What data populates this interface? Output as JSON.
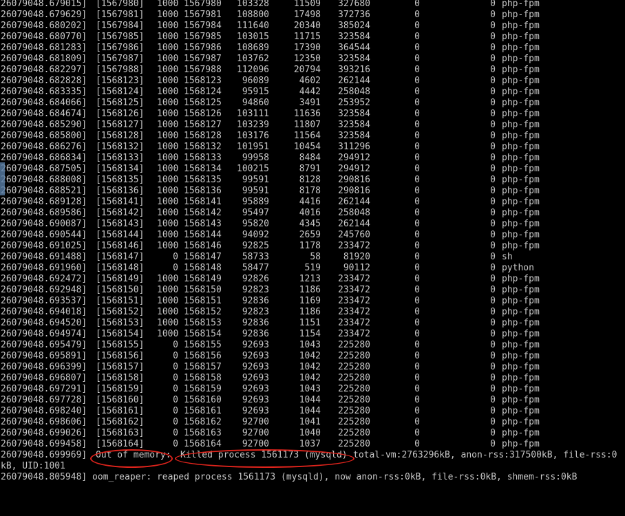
{
  "rows": [
    [
      "26079048.679015]",
      "[1567980]",
      "1000",
      "1567980",
      "103328",
      "11509",
      "327680",
      "0",
      "0",
      "php-fpm"
    ],
    [
      "26079048.679629]",
      "[1567981]",
      "1000",
      "1567981",
      "108800",
      "17498",
      "372736",
      "0",
      "0",
      "php-fpm"
    ],
    [
      "26079048.680202]",
      "[1567984]",
      "1000",
      "1567984",
      "111640",
      "20340",
      "385024",
      "0",
      "0",
      "php-fpm"
    ],
    [
      "26079048.680770]",
      "[1567985]",
      "1000",
      "1567985",
      "103015",
      "11715",
      "323584",
      "0",
      "0",
      "php-fpm"
    ],
    [
      "26079048.681283]",
      "[1567986]",
      "1000",
      "1567986",
      "108689",
      "17390",
      "364544",
      "0",
      "0",
      "php-fpm"
    ],
    [
      "26079048.681809]",
      "[1567987]",
      "1000",
      "1567987",
      "103762",
      "12350",
      "323584",
      "0",
      "0",
      "php-fpm"
    ],
    [
      "26079048.682297]",
      "[1567988]",
      "1000",
      "1567988",
      "112096",
      "20794",
      "393216",
      "0",
      "0",
      "php-fpm"
    ],
    [
      "26079048.682828]",
      "[1568123]",
      "1000",
      "1568123",
      "96089",
      "4602",
      "262144",
      "0",
      "0",
      "php-fpm"
    ],
    [
      "26079048.683335]",
      "[1568124]",
      "1000",
      "1568124",
      "95915",
      "4442",
      "258048",
      "0",
      "0",
      "php-fpm"
    ],
    [
      "26079048.684066]",
      "[1568125]",
      "1000",
      "1568125",
      "94860",
      "3491",
      "253952",
      "0",
      "0",
      "php-fpm"
    ],
    [
      "26079048.684674]",
      "[1568126]",
      "1000",
      "1568126",
      "103111",
      "11636",
      "323584",
      "0",
      "0",
      "php-fpm"
    ],
    [
      "26079048.685290]",
      "[1568127]",
      "1000",
      "1568127",
      "103239",
      "11807",
      "323584",
      "0",
      "0",
      "php-fpm"
    ],
    [
      "26079048.685800]",
      "[1568128]",
      "1000",
      "1568128",
      "103176",
      "11564",
      "323584",
      "0",
      "0",
      "php-fpm"
    ],
    [
      "26079048.686276]",
      "[1568132]",
      "1000",
      "1568132",
      "101951",
      "10454",
      "311296",
      "0",
      "0",
      "php-fpm"
    ],
    [
      "26079048.686834]",
      "[1568133]",
      "1000",
      "1568133",
      "99958",
      "8484",
      "294912",
      "0",
      "0",
      "php-fpm"
    ],
    [
      "26079048.687505]",
      "[1568134]",
      "1000",
      "1568134",
      "100215",
      "8791",
      "294912",
      "0",
      "0",
      "php-fpm"
    ],
    [
      "26079048.688008]",
      "[1568135]",
      "1000",
      "1568135",
      "99591",
      "8128",
      "290816",
      "0",
      "0",
      "php-fpm"
    ],
    [
      "26079048.688521]",
      "[1568136]",
      "1000",
      "1568136",
      "99591",
      "8178",
      "290816",
      "0",
      "0",
      "php-fpm"
    ],
    [
      "26079048.689128]",
      "[1568141]",
      "1000",
      "1568141",
      "95889",
      "4416",
      "262144",
      "0",
      "0",
      "php-fpm"
    ],
    [
      "26079048.689586]",
      "[1568142]",
      "1000",
      "1568142",
      "95497",
      "4016",
      "258048",
      "0",
      "0",
      "php-fpm"
    ],
    [
      "26079048.690087]",
      "[1568143]",
      "1000",
      "1568143",
      "95820",
      "4345",
      "262144",
      "0",
      "0",
      "php-fpm"
    ],
    [
      "26079048.690544]",
      "[1568144]",
      "1000",
      "1568144",
      "94092",
      "2659",
      "245760",
      "0",
      "0",
      "php-fpm"
    ],
    [
      "26079048.691025]",
      "[1568146]",
      "1000",
      "1568146",
      "92825",
      "1178",
      "233472",
      "0",
      "0",
      "php-fpm"
    ],
    [
      "26079048.691488]",
      "[1568147]",
      "0",
      "1568147",
      "58733",
      "58",
      "81920",
      "0",
      "0",
      "sh"
    ],
    [
      "26079048.691960]",
      "[1568148]",
      "0",
      "1568148",
      "58477",
      "519",
      "90112",
      "0",
      "0",
      "python"
    ],
    [
      "26079048.692472]",
      "[1568149]",
      "1000",
      "1568149",
      "92826",
      "1213",
      "233472",
      "0",
      "0",
      "php-fpm"
    ],
    [
      "26079048.692948]",
      "[1568150]",
      "1000",
      "1568150",
      "92823",
      "1186",
      "233472",
      "0",
      "0",
      "php-fpm"
    ],
    [
      "26079048.693537]",
      "[1568151]",
      "1000",
      "1568151",
      "92836",
      "1169",
      "233472",
      "0",
      "0",
      "php-fpm"
    ],
    [
      "26079048.694018]",
      "[1568152]",
      "1000",
      "1568152",
      "92823",
      "1186",
      "233472",
      "0",
      "0",
      "php-fpm"
    ],
    [
      "26079048.694520]",
      "[1568153]",
      "1000",
      "1568153",
      "92836",
      "1151",
      "233472",
      "0",
      "0",
      "php-fpm"
    ],
    [
      "26079048.694974]",
      "[1568154]",
      "1000",
      "1568154",
      "92836",
      "1154",
      "233472",
      "0",
      "0",
      "php-fpm"
    ],
    [
      "26079048.695479]",
      "[1568155]",
      "0",
      "1568155",
      "92693",
      "1043",
      "225280",
      "0",
      "0",
      "php-fpm"
    ],
    [
      "26079048.695891]",
      "[1568156]",
      "0",
      "1568156",
      "92693",
      "1042",
      "225280",
      "0",
      "0",
      "php-fpm"
    ],
    [
      "26079048.696399]",
      "[1568157]",
      "0",
      "1568157",
      "92693",
      "1042",
      "225280",
      "0",
      "0",
      "php-fpm"
    ],
    [
      "26079048.696807]",
      "[1568158]",
      "0",
      "1568158",
      "92693",
      "1042",
      "225280",
      "0",
      "0",
      "php-fpm"
    ],
    [
      "26079048.697291]",
      "[1568159]",
      "0",
      "1568159",
      "92693",
      "1043",
      "225280",
      "0",
      "0",
      "php-fpm"
    ],
    [
      "26079048.697728]",
      "[1568160]",
      "0",
      "1568160",
      "92693",
      "1044",
      "225280",
      "0",
      "0",
      "php-fpm"
    ],
    [
      "26079048.698240]",
      "[1568161]",
      "0",
      "1568161",
      "92693",
      "1044",
      "225280",
      "0",
      "0",
      "php-fpm"
    ],
    [
      "26079048.698606]",
      "[1568162]",
      "0",
      "1568162",
      "92700",
      "1041",
      "225280",
      "0",
      "0",
      "php-fpm"
    ],
    [
      "26079048.699026]",
      "[1568163]",
      "0",
      "1568163",
      "92700",
      "1040",
      "225280",
      "0",
      "0",
      "php-fpm"
    ],
    [
      "26079048.699458]",
      "[1568164]",
      "0",
      "1568164",
      "92700",
      "1037",
      "225280",
      "0",
      "0",
      "php-fpm"
    ]
  ],
  "oom": {
    "timestamp": "26079048.699969]",
    "out_of_memory": "Out of memory:",
    "killed": "Killed process 1561173 (mysqld)",
    "rest": "total-vm:2763296kB, anon-rss:317500kB, file-rss:0",
    "wrap": "kB, UID:1001"
  },
  "reaper": {
    "line": "26079048.805948] oom_reaper: reaped process 1561173 (mysqld), now anon-rss:0kB, file-rss:0kB, shmem-rss:0kB"
  },
  "colors": {
    "background": "#000000",
    "text": "#c8c8c8",
    "annotation": "#e0241c"
  }
}
